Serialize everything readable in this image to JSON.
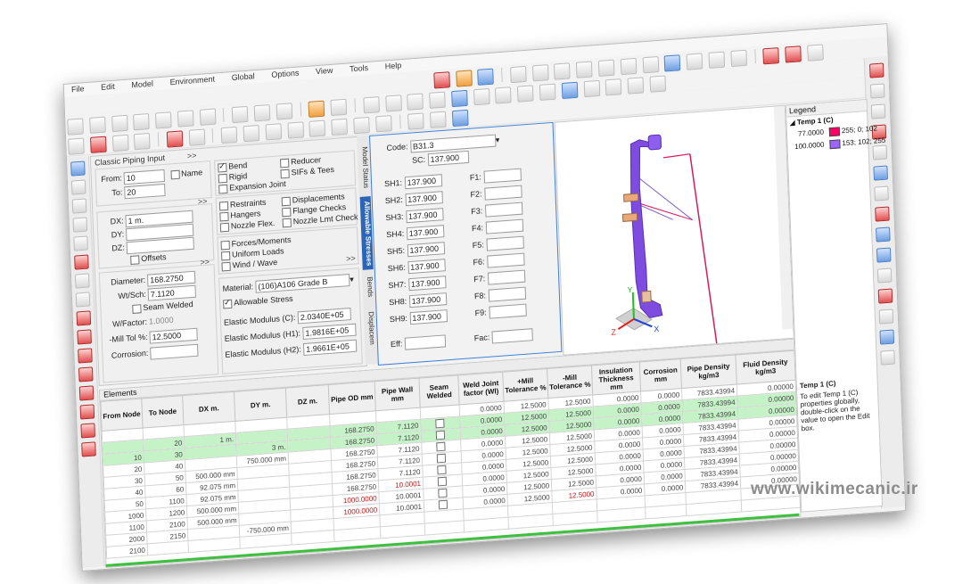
{
  "menu": [
    "File",
    "Edit",
    "Model",
    "Environment",
    "Global",
    "Options",
    "View",
    "Tools",
    "Help"
  ],
  "input": {
    "title": "Classic Piping Input",
    "from_label": "From:",
    "from_value": "10",
    "to_label": "To:",
    "to_value": "20",
    "name_label": "Name",
    "dx_label": "DX:",
    "dx_value": "1 m.",
    "dy_label": "DY:",
    "dz_label": "DZ:",
    "offsets_label": "Offsets",
    "diameter_label": "Diameter:",
    "diameter_value": "168.2750",
    "wt_label": "Wt/Sch:",
    "wt_value": "7.1120",
    "seam_label": "Seam Welded",
    "wfactor_label": "W/Factor:",
    "wfactor_value": "1.0000",
    "mill_label": "-Mill Tol %:",
    "mill_value": "12.5000",
    "corrosion_label": "Corrosion:",
    "expander": ">>",
    "bend": "Bend",
    "rigid": "Rigid",
    "expansion": "Expansion Joint",
    "reducer": "Reducer",
    "sifs": "SIFs & Tees",
    "restraints": "Restraints",
    "hangers": "Hangers",
    "nozzle_flex": "Nozzle Flex.",
    "displacements": "Displacements",
    "flange": "Flange Checks",
    "nozzle_lmt": "Nozzle Lmt Check",
    "forces": "Forces/Moments",
    "uniform": "Uniform Loads",
    "wind": "Wind / Wave",
    "material_label": "Material:",
    "material_value": "(106)A106 Grade B",
    "allow_label": "Allowable Stress",
    "em_c_label": "Elastic Modulus (C):",
    "em_c_value": "2.0340E+05",
    "em_h1_label": "Elastic Modulus (H1):",
    "em_h1_value": "1.9816E+05",
    "em_h2_label": "Elastic Modulus (H2):",
    "em_h2_value": "1.9661E+05"
  },
  "tabs": [
    "Model Status",
    "Allowable Stresses",
    "Bends",
    "Displacem"
  ],
  "stress": {
    "code_label": "Code:",
    "code_value": "B31.3",
    "sc_label": "SC:",
    "sc_value": "137.900",
    "sh": [
      {
        "label": "SH1:",
        "value": "137.900"
      },
      {
        "label": "SH2:",
        "value": "137.900"
      },
      {
        "label": "SH3:",
        "value": "137.900"
      },
      {
        "label": "SH4:",
        "value": "137.900"
      },
      {
        "label": "SH5:",
        "value": "137.900"
      },
      {
        "label": "SH6:",
        "value": "137.900"
      },
      {
        "label": "SH7:",
        "value": "137.900"
      },
      {
        "label": "SH8:",
        "value": "137.900"
      },
      {
        "label": "SH9:",
        "value": "137.900"
      }
    ],
    "f": [
      "F1:",
      "F2:",
      "F3:",
      "F4:",
      "F5:",
      "F6:",
      "F7:",
      "F8:",
      "F9:"
    ],
    "eff_label": "Eff:",
    "fac_label": "Fac:"
  },
  "axes": {
    "x": "X",
    "y": "Y",
    "z": "Z"
  },
  "legend": {
    "title": "Legend",
    "group": "Temp 1 (C)",
    "items": [
      {
        "value": "77.0000",
        "color": "#ff0066",
        "rgb": "255; 0; 102"
      },
      {
        "value": "100.0000",
        "color": "#9966ff",
        "rgb": "153; 102; 255"
      }
    ],
    "desc_title": "Temp 1 (C)",
    "desc": "To edit Temp 1 (C) properties globally, double-click on the value to open the Edit box."
  },
  "elements": {
    "title": "Elements",
    "headers": [
      "From Node",
      "To Node",
      "DX m.",
      "DY m.",
      "DZ m.",
      "Pipe OD mm",
      "Pipe Wall mm",
      "Seam Welded",
      "Weld Joint factor (Wl)",
      "+Mill Tolerance %",
      "-Mill Tolerance %",
      "Insulation Thickness mm",
      "Corrosion mm",
      "Pipe Density kg/m3",
      "Fluid Density kg/m3"
    ],
    "rows": [
      {
        "from": "",
        "to": "",
        "dx": "",
        "dy": "",
        "dz": "",
        "od": "",
        "wall": "",
        "wjf": "0.0000",
        "pmill": "12.5000",
        "mmill": "12.5000",
        "ins": "0.0000",
        "corr": "0.0000",
        "pd": "7833.43994",
        "fd": "0.00000"
      },
      {
        "from": "",
        "to": "20",
        "dx": "1 m.",
        "dy": "",
        "dz": "",
        "od": "168.2750",
        "wall": "7.1120",
        "wjf": "0.0000",
        "pmill": "12.5000",
        "mmill": "12.5000",
        "ins": "0.0000",
        "corr": "0.0000",
        "pd": "7833.43994",
        "fd": "0.00000"
      },
      {
        "from": "10",
        "to": "30",
        "dx": "",
        "dy": "3 m.",
        "dz": "",
        "od": "168.2750",
        "wall": "7.1120",
        "wjf": "0.0000",
        "pmill": "12.5000",
        "mmill": "12.5000",
        "ins": "0.0000",
        "corr": "0.0000",
        "pd": "7833.43994",
        "fd": "0.00000"
      },
      {
        "from": "20",
        "to": "40",
        "dx": "",
        "dy": "750.000 mm",
        "dz": "",
        "od": "168.2750",
        "wall": "7.1120",
        "wjf": "0.0000",
        "pmill": "12.5000",
        "mmill": "12.5000",
        "ins": "0.0000",
        "corr": "0.0000",
        "pd": "7833.43994",
        "fd": "0.00000"
      },
      {
        "from": "30",
        "to": "50",
        "dx": "500.000 mm",
        "dy": "",
        "dz": "",
        "od": "168.2750",
        "wall": "7.1120",
        "wjf": "0.0000",
        "pmill": "12.5000",
        "mmill": "12.5000",
        "ins": "0.0000",
        "corr": "0.0000",
        "pd": "7833.43994",
        "fd": "0.00000"
      },
      {
        "from": "40",
        "to": "60",
        "dx": "92.075 mm",
        "dy": "",
        "dz": "",
        "od": "168.2750",
        "wall": "7.1120",
        "wjf": "0.0000",
        "pmill": "12.5000",
        "mmill": "12.5000",
        "ins": "0.0000",
        "corr": "0.0000",
        "pd": "7833.43994",
        "fd": "0.00000"
      },
      {
        "from": "50",
        "to": "1100",
        "dx": "92.075 mm",
        "dy": "",
        "dz": "",
        "od": "168.2750",
        "wall": "10.0001",
        "wjf": "0.0000",
        "pmill": "12.5000",
        "mmill": "12.5000",
        "ins": "0.0000",
        "corr": "0.0000",
        "pd": "7833.43994",
        "fd": "0.00000"
      },
      {
        "from": "1000",
        "to": "1200",
        "dx": "500.000 mm",
        "dy": "",
        "dz": "",
        "od": "1000.0000",
        "wall": "10.0001",
        "wjf": "0.0000",
        "pmill": "12.5000",
        "mmill": "12.5000",
        "ins": "0.0000",
        "corr": "0.0000",
        "pd": "7833.43994",
        "fd": "0.00000"
      },
      {
        "from": "1100",
        "to": "2100",
        "dx": "500.000 mm",
        "dy": "",
        "dz": "",
        "od": "1000.0000",
        "wall": "10.0001",
        "wjf": "0.0000",
        "pmill": "12.5000",
        "mmill": "12.5000",
        "ins": "0.0000",
        "corr": "0.0000",
        "pd": "7833.43994",
        "fd": "0.00000"
      },
      {
        "from": "2000",
        "to": "2150",
        "dx": "",
        "dy": "-750.000 mm",
        "dz": "",
        "od": "",
        "wall": "",
        "wjf": "",
        "pmill": "",
        "mmill": "",
        "ins": "",
        "corr": "",
        "pd": "",
        "fd": ""
      },
      {
        "from": "2100",
        "to": "",
        "dx": "",
        "dy": "",
        "dz": "",
        "od": "",
        "wall": "",
        "wjf": "",
        "pmill": "",
        "mmill": "",
        "ins": "",
        "corr": "",
        "pd": "",
        "fd": ""
      }
    ]
  },
  "watermark": "www.wikimecanic.ir"
}
